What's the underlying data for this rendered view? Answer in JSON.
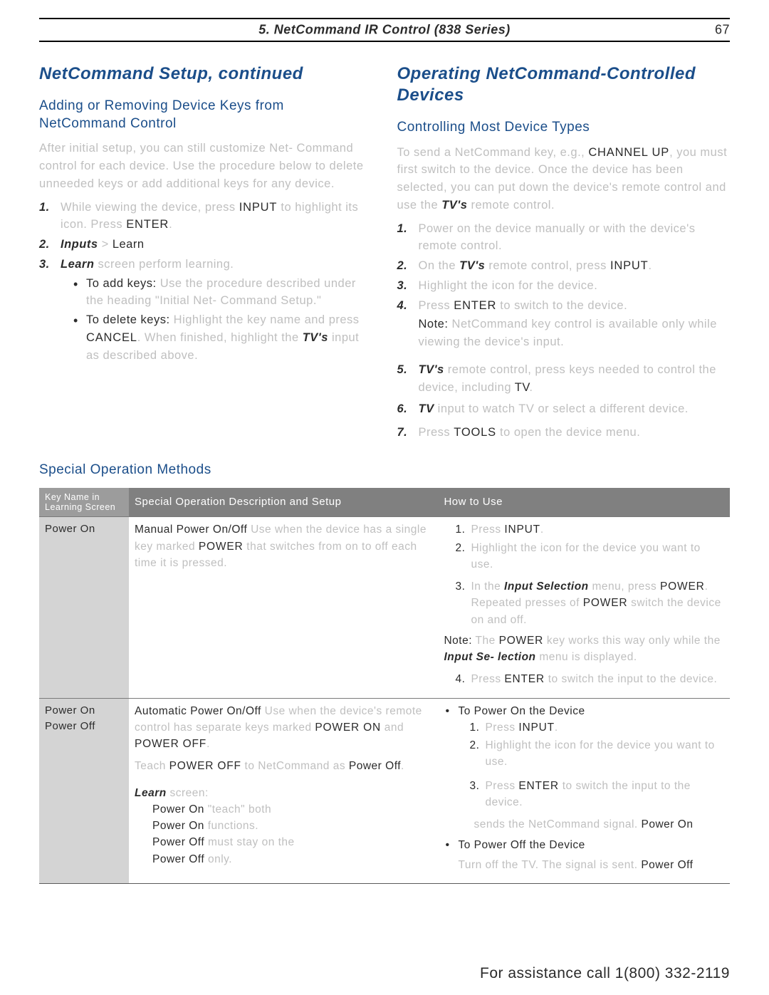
{
  "header": {
    "title": "5.  NetCommand IR Control (838 Series)",
    "pagenum": "67"
  },
  "left": {
    "h1": "NetCommand Setup, continued",
    "h2": "Adding or Removing Device Keys from NetCommand Control",
    "intro_faint": "After initial setup, you can still customize Net- Command control for each device. Use the procedure below to delete unneeded keys or add additional keys for any device.",
    "step1_lead_faint": "While viewing the device, press ",
    "step1_input": "INPUT",
    "step1_mid_faint": " to highlight its icon. Press ",
    "step1_enter": "ENTER",
    "step1_end_faint": ".",
    "step2_label": "Inputs",
    "step2_faint_a": " > ",
    "step2_learn": "Learn",
    "step3_label": "Learn",
    "step3_faint": "  screen perform learning.",
    "bul_add": "To add keys:",
    "bul_add_faint": " Use the procedure described under the heading \"Initial Net- Command Setup.\"",
    "bul_del": "To delete keys:",
    "bul_del_faint_a": " Highlight the key name and press ",
    "bul_del_cancel": "CANCEL",
    "bul_del_faint_b": ".  When finished, highlight the ",
    "bul_del_tvs": "TV's",
    "bul_del_faint_c": " input as described above."
  },
  "right": {
    "h1": "Operating NetCommand-Controlled Devices",
    "h2": "Controlling Most Device Types",
    "intro_faint_a": "To send a NetCommand key, e.g., ",
    "intro_chup": "CHANNEL UP",
    "intro_faint_b": ", you must first switch to the device. Once the device has been selected, you can put down the device's remote control and use the ",
    "intro_tvs": "TV's",
    "intro_faint_c": " remote control.",
    "s1_faint": "Power on the device manually or with the device's remote control.",
    "s2_faint_a": "On the ",
    "s2_tvs": "TV's",
    "s2_faint_b": " remote control, press ",
    "s2_input": "INPUT",
    "s2_faint_c": ".",
    "s3_faint": "Highlight the icon for the device.",
    "s4_faint_a": "Press ",
    "s4_enter": "ENTER",
    "s4_faint_b": " to switch to the device.",
    "note": "Note:",
    "note_faint": " NetCommand key control is available only while viewing the device's input.",
    "s5_tvs": "TV's",
    "s5_faint_a": " remote control, press keys needed to control the device, including ",
    "s5_tv": "TV",
    "s5_faint_b": ".",
    "s6_tv": "TV",
    "s6_faint": " input to watch TV or select a different device.",
    "s7_faint_a": "Press ",
    "s7_tools": "TOOLS",
    "s7_faint_b": " to open the device menu."
  },
  "specialHeading": "Special Operation Methods",
  "table": {
    "head": [
      "Key Name in Learning Screen",
      "Special Operation Description and Setup",
      "How to Use"
    ],
    "row1": {
      "k": "Power On",
      "desc_lead": "Manual Power On/Off",
      "desc_faint_a": " Use when the device has a single key marked ",
      "desc_power": "POWER",
      "desc_faint_b": " that switches from on to off each time it is pressed.",
      "use_s1_a": "Press ",
      "use_s1_input": "INPUT",
      "use_s1_b": ".",
      "use_s2": "Highlight the icon for the device you want to use.",
      "use_s3_label": "Input Selection",
      "use_s3_faint_a_pre": "In the ",
      "use_s3_faint_a": " menu, press ",
      "use_s3_power1": "POWER",
      "use_s3_faint_b": ". Repeated presses of ",
      "use_s3_power2": "POWER",
      "use_s3_faint_c": " switch the device on and off.",
      "use_note": "Note:",
      "use_note_faint_a": " The ",
      "use_note_power": "POWER",
      "use_note_sel": "Input Se- lection",
      "use_note_faint_b": " key works this way only while the ",
      "use_note_faint_c": " menu is displayed.",
      "use_s4_a": "Press ",
      "use_s4_enter": "ENTER",
      "use_s4_b": " to switch the input to the device."
    },
    "row2": {
      "k1": "Power On",
      "k2": "Power Off",
      "d_lead": "Automatic Power On/Off",
      "d_faint_a": " Use when the device's remote control has separate keys marked ",
      "d_pon": "POWER ON",
      "d_faint_b": " and ",
      "d_poff": "POWER OFF",
      "d_faint_c": ".",
      "d_faint_d": "Teach ",
      "d_poff2": "POWER OFF",
      "d_pofftxt": "Power Off",
      "d_faint_e": " to NetCommand as ",
      "d_faint_f": ".",
      "d_learn": "Learn",
      "d_faint_g": "  screen:",
      "d_li1a": "Power On",
      "d_li1b_faint": " \"teach\" both",
      "d_li1c": "Power On",
      "d_li1d_faint": " functions.",
      "d_li2a": "Power Off",
      "d_li2b_faint": " must stay on the ",
      "d_li2c": "Power Off",
      "d_li2d_faint": " only.",
      "u_on": "To Power On the Device",
      "u_on1_a": "Press ",
      "u_on1_input": "INPUT",
      "u_on1_b": ".",
      "u_on2": "Highlight the icon for the device you want to use.",
      "u_on3_a": "Press ",
      "u_on3_enter": "ENTER",
      "u_on3_b": " to switch the input to the device.",
      "u_on_pwr": "Power On",
      "u_on_pwr_faint": " sends the NetCommand  signal.",
      "u_off": "To Power Off the Device",
      "u_off_faint_a": "Turn off the TV. The  signal is sent.",
      "u_off_pwr": "Power Off"
    }
  },
  "footer": "For assistance call 1(800) 332-2119"
}
